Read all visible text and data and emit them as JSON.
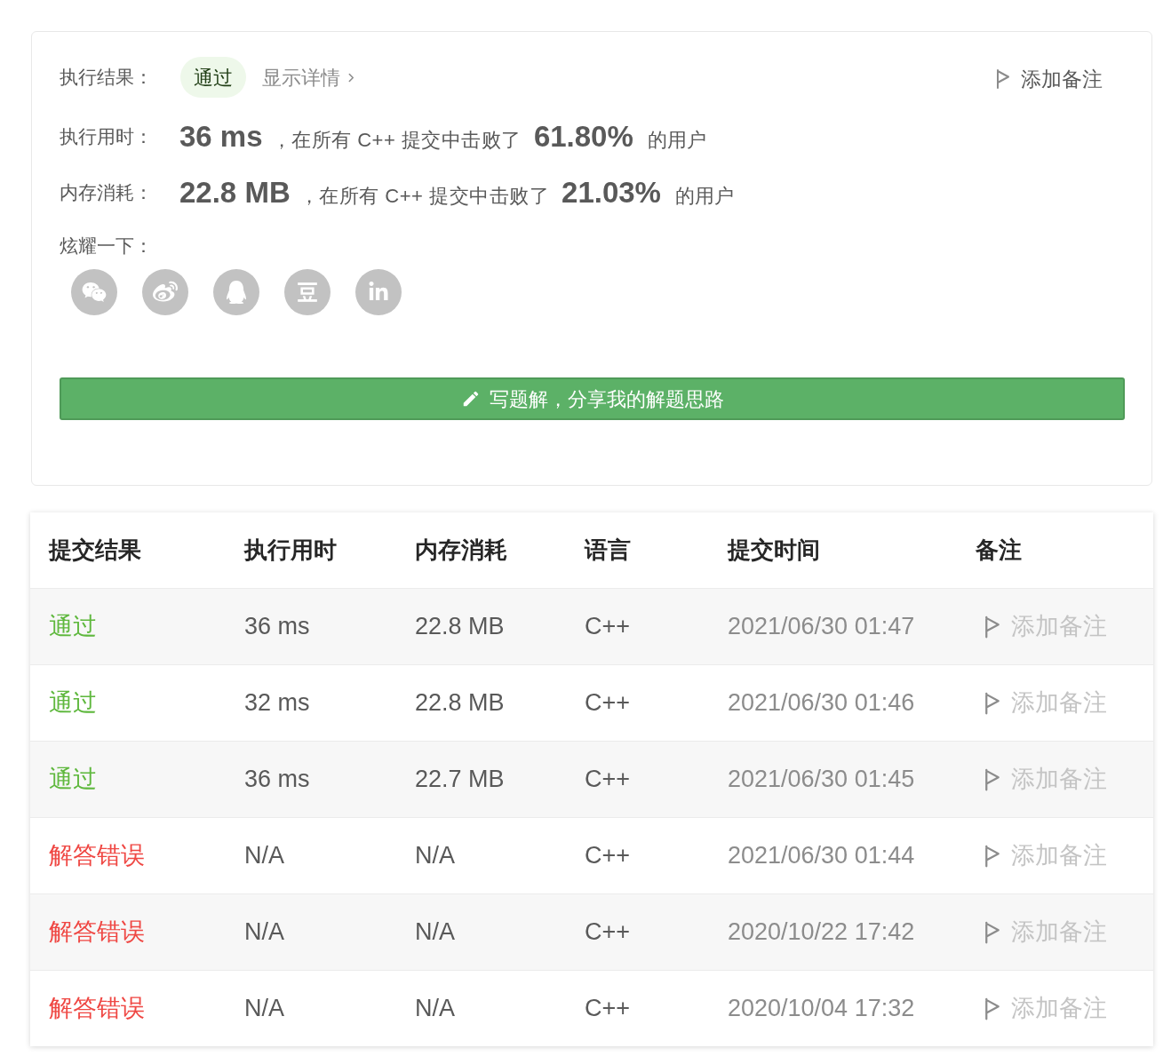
{
  "result_card": {
    "result_label": "执行结果：",
    "status": {
      "text": "通过",
      "kind": "accepted"
    },
    "details_link": "显示详情",
    "note_button": "添加备注",
    "stats": [
      {
        "label": "执行用时：",
        "value": "36 ms",
        "text": "，在所有 C++ 提交中击败了",
        "percent": "61.80%",
        "suffix": "的用户"
      },
      {
        "label": "内存消耗：",
        "value": "22.8 MB",
        "text": "，在所有 C++ 提交中击败了",
        "percent": "21.03%",
        "suffix": "的用户"
      }
    ],
    "share_label": "炫耀一下：",
    "write_button": "写题解，分享我的解题思路"
  },
  "submissions": {
    "columns": [
      "提交结果",
      "执行用时",
      "内存消耗",
      "语言",
      "提交时间",
      "备注"
    ],
    "rows": [
      {
        "result": {
          "text": "通过",
          "kind": "accepted"
        },
        "runtime": "36 ms",
        "memory": "22.8 MB",
        "language": "C++",
        "time": "2021/06/30 01:47",
        "note": "添加备注"
      },
      {
        "result": {
          "text": "通过",
          "kind": "accepted"
        },
        "runtime": "32 ms",
        "memory": "22.8 MB",
        "language": "C++",
        "time": "2021/06/30 01:46",
        "note": "添加备注"
      },
      {
        "result": {
          "text": "通过",
          "kind": "accepted"
        },
        "runtime": "36 ms",
        "memory": "22.7 MB",
        "language": "C++",
        "time": "2021/06/30 01:45",
        "note": "添加备注"
      },
      {
        "result": {
          "text": "解答错误",
          "kind": "wrong_answer"
        },
        "runtime": "N/A",
        "memory": "N/A",
        "language": "C++",
        "time": "2021/06/30 01:44",
        "note": "添加备注"
      },
      {
        "result": {
          "text": "解答错误",
          "kind": "wrong_answer"
        },
        "runtime": "N/A",
        "memory": "N/A",
        "language": "C++",
        "time": "2020/10/22 17:42",
        "note": "添加备注"
      },
      {
        "result": {
          "text": "解答错误",
          "kind": "wrong_answer"
        },
        "runtime": "N/A",
        "memory": "N/A",
        "language": "C++",
        "time": "2020/10/04 17:32",
        "note": "添加备注"
      }
    ]
  }
}
